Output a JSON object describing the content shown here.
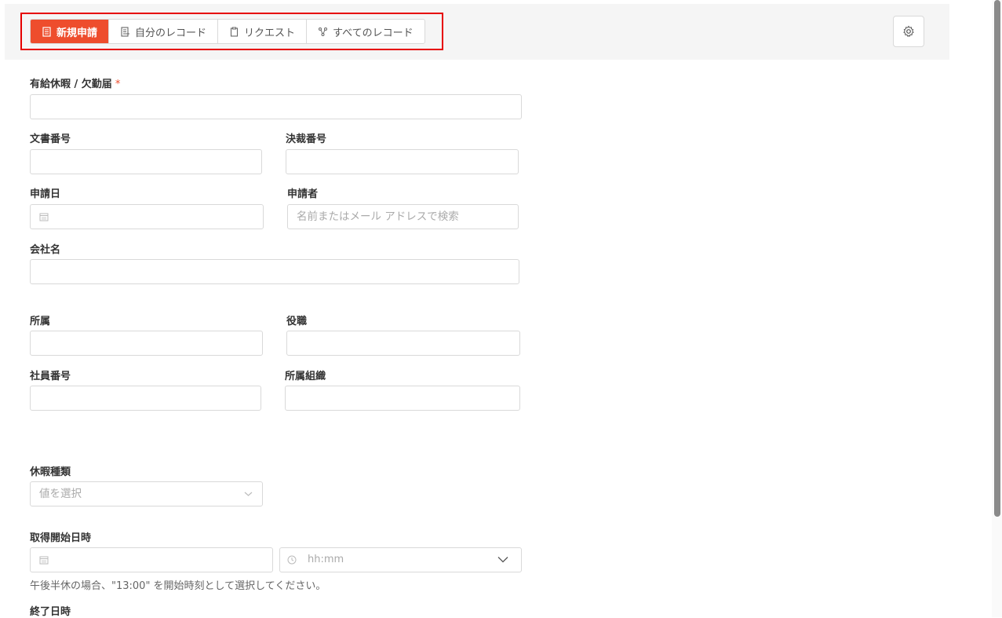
{
  "tabs": [
    {
      "label": "新規申請",
      "icon": "document-icon"
    },
    {
      "label": "自分のレコード",
      "icon": "list-document-icon"
    },
    {
      "label": "リクエスト",
      "icon": "clipboard-icon"
    },
    {
      "label": "すべてのレコード",
      "icon": "network-icon"
    }
  ],
  "colors": {
    "accent": "#ee4d2d",
    "highlight": "#e60000"
  },
  "form": {
    "title_field": {
      "label": "有給休暇 / 欠勤届",
      "required_mark": "*"
    },
    "doc_number": {
      "label": "文書番号"
    },
    "decision_number": {
      "label": "決裁番号"
    },
    "apply_date": {
      "label": "申請日"
    },
    "applicant": {
      "label": "申請者",
      "placeholder": "名前またはメール アドレスで検索"
    },
    "company": {
      "label": "会社名"
    },
    "department": {
      "label": "所属"
    },
    "position": {
      "label": "役職"
    },
    "employee_number": {
      "label": "社員番号"
    },
    "organization": {
      "label": "所属組織"
    },
    "leave_type": {
      "label": "休暇種類",
      "placeholder": "値を選択"
    },
    "start_datetime": {
      "label": "取得開始日時",
      "time_placeholder": "hh:mm",
      "hint": "午後半休の場合、\"13:00\" を開始時刻として選択してください。"
    },
    "end_datetime": {
      "label": "終了日時"
    }
  }
}
